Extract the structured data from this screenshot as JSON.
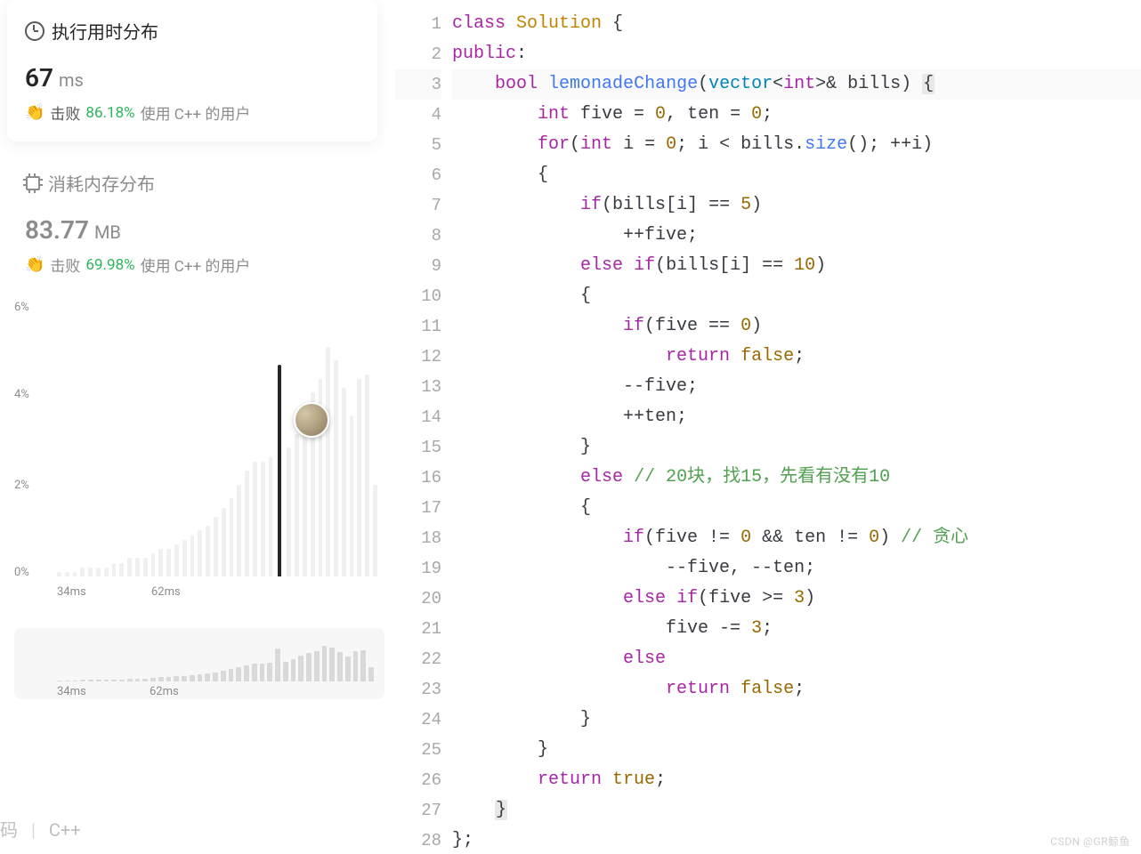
{
  "runtime_card": {
    "title": "执行用时分布",
    "value": "67",
    "unit": "ms",
    "beat_label": "击败",
    "beat_pct": "86.18%",
    "beat_suffix": "使用 C++ 的用户"
  },
  "memory_card": {
    "title": "消耗内存分布",
    "value": "83.77",
    "unit": "MB",
    "beat_label": "击败",
    "beat_pct": "69.98%",
    "beat_suffix": "使用 C++ 的用户"
  },
  "chart": {
    "yticks": [
      "6%",
      "4%",
      "2%",
      "0%"
    ],
    "xlabels": [
      "34ms",
      "62ms"
    ],
    "mini_xlabels": [
      "34ms",
      "62ms"
    ]
  },
  "tabs": {
    "left": "码",
    "right": "C++"
  },
  "watermark": "CSDN @GR鲸鱼",
  "chart_data": {
    "type": "bar",
    "title": "执行用时分布",
    "xlabel": "ms",
    "ylabel": "percent",
    "ylim": [
      0,
      6
    ],
    "x_start": 34,
    "x_marker": 62,
    "highlight_x": 67,
    "values_percent": [
      0.1,
      0.1,
      0.1,
      0.2,
      0.2,
      0.2,
      0.2,
      0.3,
      0.3,
      0.4,
      0.4,
      0.4,
      0.5,
      0.6,
      0.6,
      0.7,
      0.8,
      0.9,
      1.0,
      1.1,
      1.3,
      1.5,
      1.7,
      2.0,
      2.3,
      2.5,
      2.5,
      2.6,
      4.6,
      2.8,
      3.1,
      3.6,
      4.0,
      4.3,
      5.0,
      4.7,
      4.1,
      3.5,
      4.3,
      4.4,
      2.0
    ]
  },
  "code": {
    "active_line": 3,
    "lines": [
      [
        {
          "t": "k",
          "v": "class"
        },
        {
          "v": " "
        },
        {
          "t": "cls",
          "v": "Solution"
        },
        {
          "v": " {"
        }
      ],
      [
        {
          "t": "k",
          "v": "public"
        },
        {
          "v": ":"
        }
      ],
      [
        {
          "v": "    "
        },
        {
          "t": "k",
          "v": "bool"
        },
        {
          "v": " "
        },
        {
          "t": "fn",
          "v": "lemonadeChange"
        },
        {
          "v": "("
        },
        {
          "t": "t",
          "v": "vector"
        },
        {
          "v": "<"
        },
        {
          "t": "k",
          "v": "int"
        },
        {
          "v": ">& bills) "
        },
        {
          "t": "hl",
          "v": "{"
        }
      ],
      [
        {
          "v": "        "
        },
        {
          "t": "k",
          "v": "int"
        },
        {
          "v": " five = "
        },
        {
          "t": "n",
          "v": "0"
        },
        {
          "v": ", ten = "
        },
        {
          "t": "n",
          "v": "0"
        },
        {
          "v": ";"
        }
      ],
      [
        {
          "v": "        "
        },
        {
          "t": "k",
          "v": "for"
        },
        {
          "v": "("
        },
        {
          "t": "k",
          "v": "int"
        },
        {
          "v": " i = "
        },
        {
          "t": "n",
          "v": "0"
        },
        {
          "v": "; i < bills."
        },
        {
          "t": "fn",
          "v": "size"
        },
        {
          "v": "(); ++i)"
        }
      ],
      [
        {
          "v": "        {"
        }
      ],
      [
        {
          "v": "            "
        },
        {
          "t": "k",
          "v": "if"
        },
        {
          "v": "(bills[i] == "
        },
        {
          "t": "n",
          "v": "5"
        },
        {
          "v": ")"
        }
      ],
      [
        {
          "v": "                ++five;"
        }
      ],
      [
        {
          "v": "            "
        },
        {
          "t": "k",
          "v": "else"
        },
        {
          "v": " "
        },
        {
          "t": "k",
          "v": "if"
        },
        {
          "v": "(bills[i] == "
        },
        {
          "t": "n",
          "v": "10"
        },
        {
          "v": ")"
        }
      ],
      [
        {
          "v": "            {"
        }
      ],
      [
        {
          "v": "                "
        },
        {
          "t": "k",
          "v": "if"
        },
        {
          "v": "(five == "
        },
        {
          "t": "n",
          "v": "0"
        },
        {
          "v": ")"
        }
      ],
      [
        {
          "v": "                    "
        },
        {
          "t": "k",
          "v": "return"
        },
        {
          "v": " "
        },
        {
          "t": "n",
          "v": "false"
        },
        {
          "v": ";"
        }
      ],
      [
        {
          "v": "                --five;"
        }
      ],
      [
        {
          "v": "                ++ten;"
        }
      ],
      [
        {
          "v": "            }"
        }
      ],
      [
        {
          "v": "            "
        },
        {
          "t": "k",
          "v": "else"
        },
        {
          "v": " "
        },
        {
          "t": "c",
          "v": "// 20块，找15，先看有没有10"
        }
      ],
      [
        {
          "v": "            {"
        }
      ],
      [
        {
          "v": "                "
        },
        {
          "t": "k",
          "v": "if"
        },
        {
          "v": "(five != "
        },
        {
          "t": "n",
          "v": "0"
        },
        {
          "v": " && ten != "
        },
        {
          "t": "n",
          "v": "0"
        },
        {
          "v": ") "
        },
        {
          "t": "c",
          "v": "// 贪心"
        }
      ],
      [
        {
          "v": "                    --five, --ten;"
        }
      ],
      [
        {
          "v": "                "
        },
        {
          "t": "k",
          "v": "else"
        },
        {
          "v": " "
        },
        {
          "t": "k",
          "v": "if"
        },
        {
          "v": "(five >= "
        },
        {
          "t": "n",
          "v": "3"
        },
        {
          "v": ")"
        }
      ],
      [
        {
          "v": "                    five -= "
        },
        {
          "t": "n",
          "v": "3"
        },
        {
          "v": ";"
        }
      ],
      [
        {
          "v": "                "
        },
        {
          "t": "k",
          "v": "else"
        }
      ],
      [
        {
          "v": "                    "
        },
        {
          "t": "k",
          "v": "return"
        },
        {
          "v": " "
        },
        {
          "t": "n",
          "v": "false"
        },
        {
          "v": ";"
        }
      ],
      [
        {
          "v": "            }"
        }
      ],
      [
        {
          "v": "        }"
        }
      ],
      [
        {
          "v": "        "
        },
        {
          "t": "k",
          "v": "return"
        },
        {
          "v": " "
        },
        {
          "t": "n",
          "v": "true"
        },
        {
          "v": ";"
        }
      ],
      [
        {
          "v": "    "
        },
        {
          "t": "hl",
          "v": "}"
        }
      ],
      [
        {
          "v": "};"
        }
      ]
    ]
  }
}
